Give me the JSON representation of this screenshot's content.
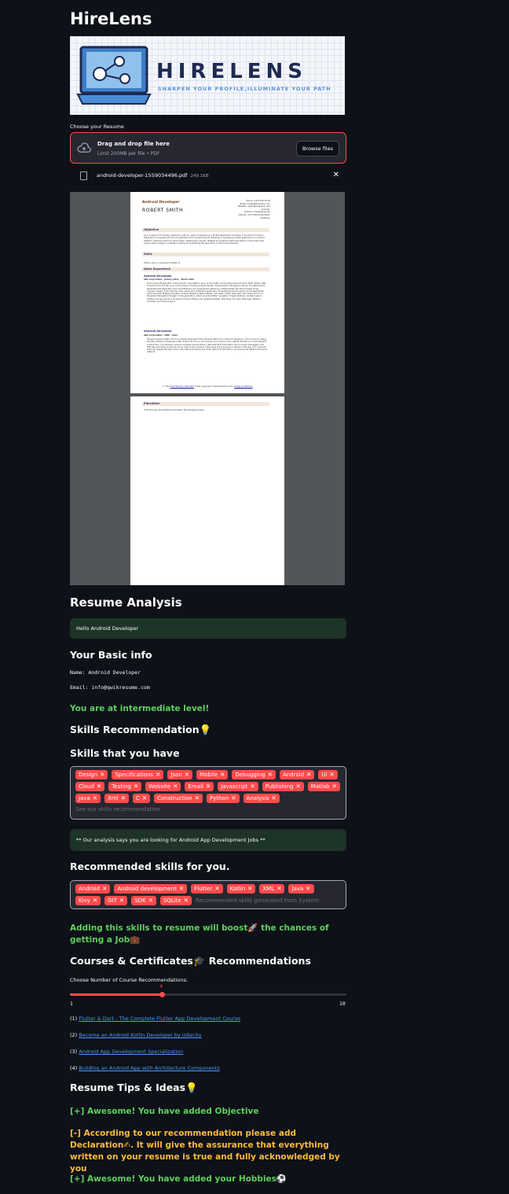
{
  "app": {
    "title": "HireLens"
  },
  "logo": {
    "brand": "HIRELENS",
    "tagline": "SHARPEN YOUR PROFILE,ILLUMINATE YOUR PATH"
  },
  "upload": {
    "label": "Choose your Resume",
    "drag_text": "Drag and drop file here",
    "limit_text": "Limit 200MB per file • PDF",
    "browse_label": "Browse files",
    "file_name": "android-developer-1559034496.pdf",
    "file_size": "249.1KB"
  },
  "pdf": {
    "role": "Android Developer",
    "name": "ROBERT SMITH",
    "contact": [
      "Phone: (123) 456 78 99",
      "Email: info@qwikresume.com",
      "Website: www.qwikresume.com",
      "LinkedIn:",
      "linkedin.com/qwikresume",
      "Address: 1737 Marshville Road,",
      "Alabama."
    ],
    "sec_objective": "Objective",
    "objective_text": "Over 6 years of IT Industry experience with 4+ years of experience in Mobile application developer in the field of Android. Experience in developing front end applications for Android phones. Experience developing mobile applications on Android platform, building Custom UI using Views, ViewGroups, Layouts, Widgets and graphics that scale based on the screen size using 9-patch images, localization, testing and publishing the application to the Android Market.",
    "sec_skills": "Skills",
    "skills_text": "Python, Java, C, Javascript, Matlab, R.",
    "sec_work": "Work Experience",
    "job1_title": "Android Developer",
    "job1_meta": "ABC Corporation - January 2011 – March 2012",
    "job1_text": "Environment Eclipse IDE, Android Studio, GenyMotion, Java, Android SDK, Android Development Tools (ADT), SQLite, XML. Involved in the full life cycle of the project including analysis design, development, debugging, testing, and deployment. Developed the application from specifications and requirement gathering. Independently handled modules scope, analysis, design, build, test the code, debug and implement application. Developed products section of the application which provided Multiple Activities, Custom Adapters, Base Adapter, List views, Limits, Web View, Text Views and so on. Developed Navigation Drawer for the application, which provides better navigation of apps features. Created new UI Screens and key resource for layout UI work utilizing xml, Shape Drawable, Text View, List View, Web View, Buttons, Activities, and Frame Layout.",
    "job2_title": "Android Developer",
    "job2_meta": "ABC Corporation - 2006 – 2011",
    "job2_text": "Helped develop Insight, which is a tablet application that retrieves data from a CPS and displays it. This is done to debug the CPS, activity in pressures Insite. Pulled info from a cloud server and coded it onto a tablet. Worked on UI and backend construction. Connected to various computer boards where I retrieved Wi-Fi information from a server. Debugged code that was previously worked on by an outsourced company. There were many bugs and crashes in the app, and I resolved them all, despite the size of the code. Retrieved wiring and tooler data from the CPS by connecting the tablet to the same network.",
    "footer_pre": "© This ",
    "footer_link": "Free Resume Template",
    "footer_mid": " is the copyright of Qwikresume.com. ",
    "footer_usage": "Usage Guidelines",
    "sec_education": "Education",
    "education_text": "IT Technology, 2011(Qutent Information Technologies Center)"
  },
  "analysis": {
    "heading": "Resume Analysis",
    "greeting": "Hello Android Developer",
    "basic_info_heading": "Your Basic info",
    "name_line": "Name: Android Developer",
    "email_line": "Email: info@qwikresume.com",
    "level": "You are at intermediate level!",
    "skills_rec_heading": "Skills Recommendation💡",
    "skills_have_heading": "Skills that you have",
    "skills_have": [
      "Design",
      "Specifications",
      "Json",
      "Mobile",
      "Debugging",
      "Android",
      "Ui",
      "Cloud",
      "Testing",
      "Website",
      "Email",
      "Javascript",
      "Publishing",
      "Matlab",
      "Java",
      "Xml",
      "C",
      "Construction",
      "Python",
      "Analysis"
    ],
    "skills_placeholder": "See our skills recommendation",
    "job_notice": "** Our analysis says you are looking for Android App Development Jobs **",
    "recommended_heading": "Recommended skills for you.",
    "recommended_skills": [
      "Android",
      "Android development",
      "Flutter",
      "Kotlin",
      "XML",
      "Java",
      "Kivy",
      "GIT",
      "SDK",
      "SQLite"
    ],
    "recommended_placeholder": "Recommended skills generated from System",
    "boost_text": "Adding this skills to resume will boost🚀 the chances of getting a Job💼"
  },
  "courses": {
    "heading": "Courses & Certificates🎓 Recommendations",
    "slider_label": "Choose Number of Course Recommendations:",
    "slider_value": "4",
    "slider_value_num": 4,
    "slider_min": "1",
    "slider_max": "10",
    "items": [
      {
        "num": "(1)",
        "title": "Flutter & Dart - The Complete Flutter App Development Course"
      },
      {
        "num": "(2)",
        "title": "Become an Android Kotlin Developer by Udacity"
      },
      {
        "num": "(3)",
        "title": "Android App Development Specialization"
      },
      {
        "num": "(4)",
        "title": "Building an Android App with Architecture Components"
      }
    ]
  },
  "tips": {
    "heading": "Resume Tips & Ideas💡",
    "objective_ok": "[+] Awesome! You have added Objective",
    "declaration_missing": "[-] According to our recommendation please add Declaration✍. It will give the assurance that everything written on your resume is true and fully acknowledged by you",
    "hobbies_ok": "[+] Awesome! You have added your Hobbies⚽"
  },
  "colors": {
    "accent": "#ff4b4b",
    "success_text": "#5ecf5e",
    "warning_text": "#fdba3b",
    "link": "#4a9cff",
    "background": "#0e1117"
  }
}
